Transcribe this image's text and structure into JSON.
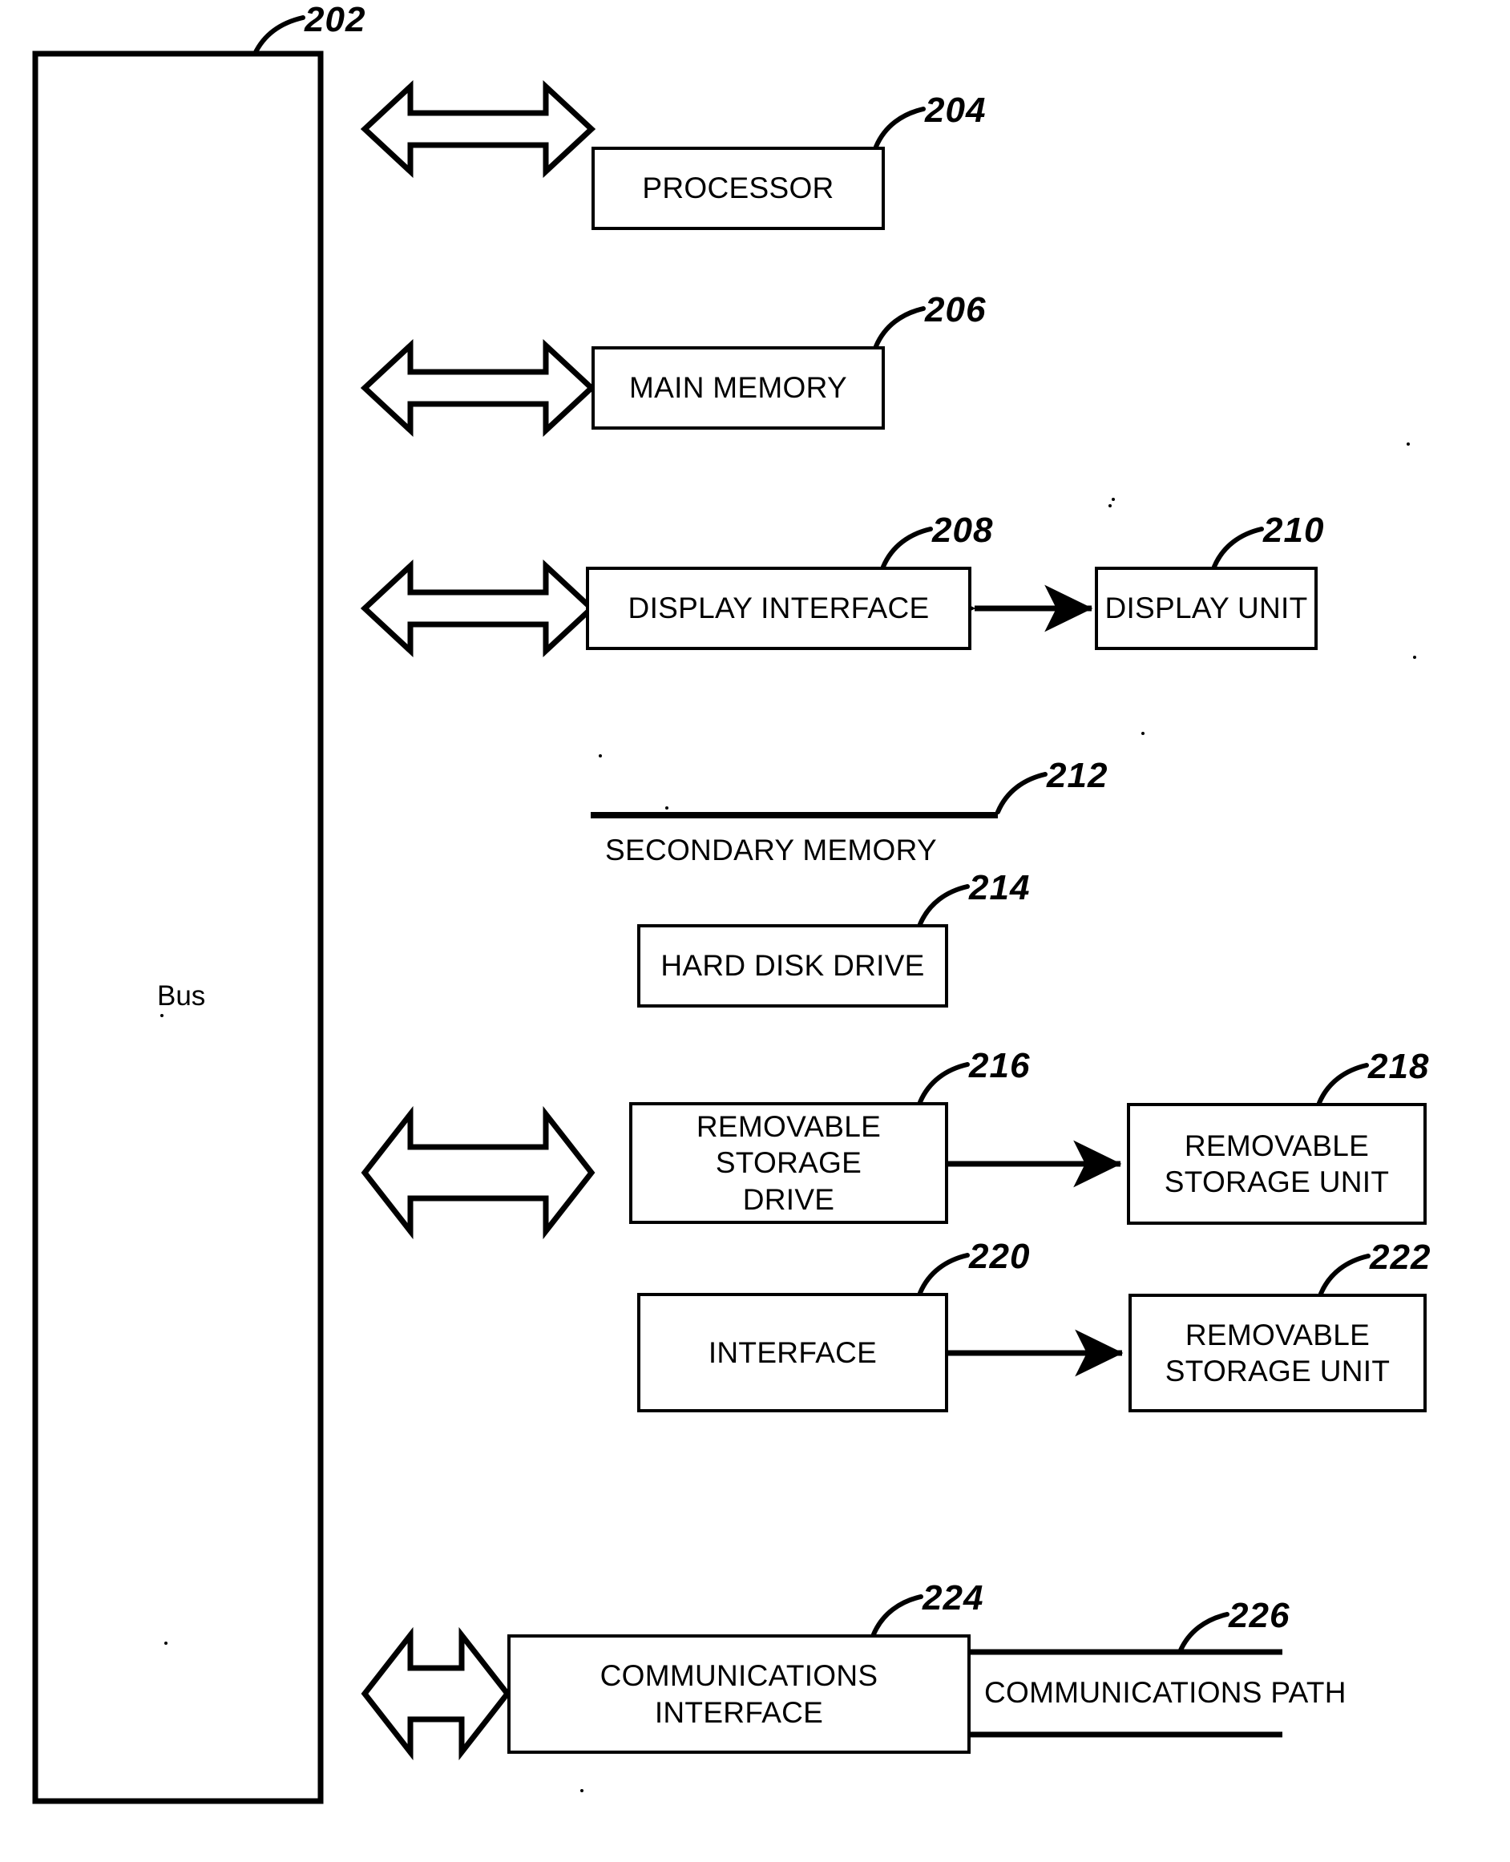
{
  "figure": {
    "type": "patent-block-diagram",
    "bus": {
      "label": "Bus",
      "ref": "202"
    },
    "blocks": [
      {
        "id": "processor",
        "ref": "204",
        "label": "PROCESSOR"
      },
      {
        "id": "main-memory",
        "ref": "206",
        "label": "MAIN MEMORY"
      },
      {
        "id": "display-interface",
        "ref": "208",
        "label": "DISPLAY INTERFACE"
      },
      {
        "id": "display-unit",
        "ref": "210",
        "label": "DISPLAY UNIT"
      },
      {
        "id": "secondary-memory",
        "ref": "212",
        "label": "SECONDARY MEMORY"
      },
      {
        "id": "hard-disk-drive",
        "ref": "214",
        "label": "HARD DISK DRIVE"
      },
      {
        "id": "removable-storage-drive",
        "ref": "216",
        "label_line1": "REMOVABLE STORAGE",
        "label_line2": "DRIVE"
      },
      {
        "id": "removable-storage-unit-218",
        "ref": "218",
        "label_line1": "REMOVABLE",
        "label_line2": "STORAGE UNIT"
      },
      {
        "id": "interface",
        "ref": "220",
        "label": "INTERFACE"
      },
      {
        "id": "removable-storage-unit-222",
        "ref": "222",
        "label_line1": "REMOVABLE",
        "label_line2": "STORAGE UNIT"
      },
      {
        "id": "communications-interface",
        "ref": "224",
        "label_line1": "COMMUNICATIONS",
        "label_line2": "INTERFACE"
      },
      {
        "id": "communications-path",
        "ref": "226",
        "label": "COMMUNICATIONS PATH"
      }
    ],
    "colors": {
      "ink": "#000000",
      "paper": "#ffffff"
    }
  }
}
